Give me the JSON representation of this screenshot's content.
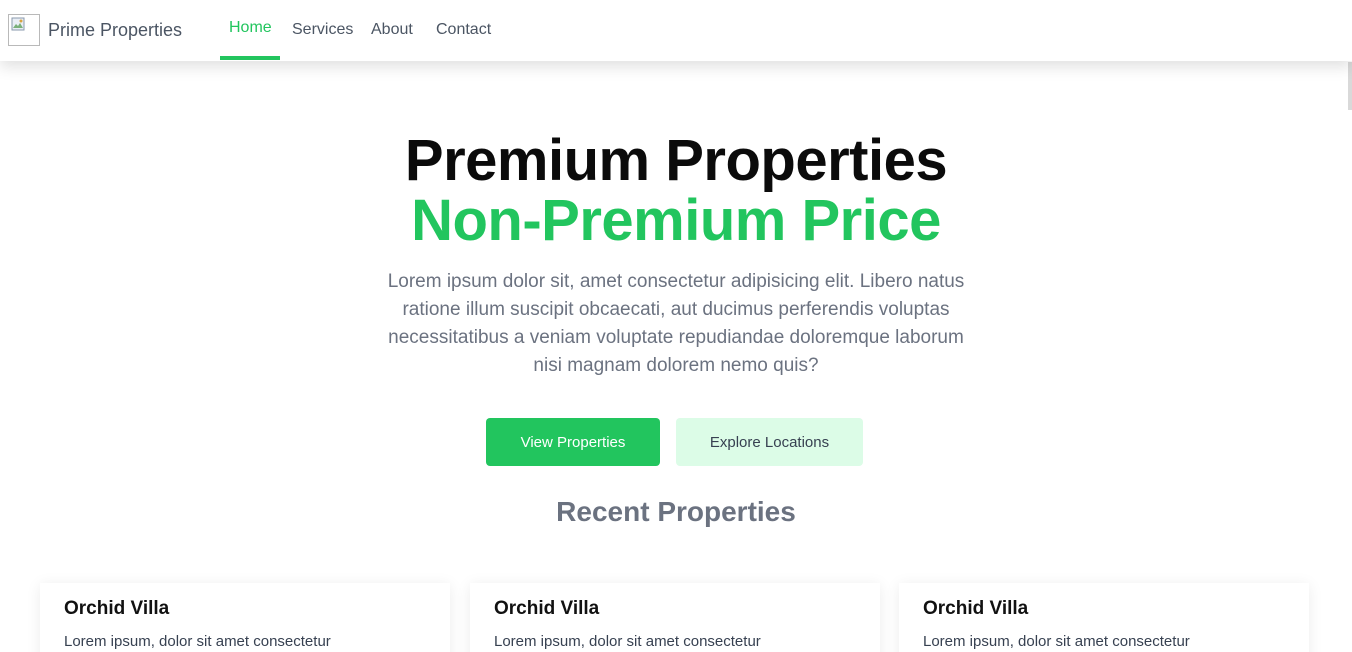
{
  "header": {
    "brand": "Prime Properties",
    "nav": [
      {
        "label": "Home",
        "active": true
      },
      {
        "label": "Services",
        "active": false
      },
      {
        "label": "About",
        "active": false
      },
      {
        "label": "Contact",
        "active": false
      }
    ]
  },
  "hero": {
    "title": "Premium Properties",
    "subtitle": "Non-Premium Price",
    "description": "Lorem ipsum dolor sit, amet consectetur adipisicing elit. Libero natus ratione illum suscipit obcaecati, aut ducimus perferendis voluptas necessitatibus a veniam voluptate repudiandae doloremque laborum nisi magnam dolorem nemo quis?",
    "primary_button": "View Properties",
    "secondary_button": "Explore Locations"
  },
  "recent": {
    "title": "Recent Properties",
    "cards": [
      {
        "title": "Orchid Villa",
        "description": "Lorem ipsum, dolor sit amet consectetur"
      },
      {
        "title": "Orchid Villa",
        "description": "Lorem ipsum, dolor sit amet consectetur"
      },
      {
        "title": "Orchid Villa",
        "description": "Lorem ipsum, dolor sit amet consectetur"
      }
    ]
  },
  "colors": {
    "accent": "#22c55e",
    "accent_light": "#dcfce7",
    "text_muted": "#6b7280"
  },
  "icons": {
    "logo": "broken-image-icon"
  }
}
